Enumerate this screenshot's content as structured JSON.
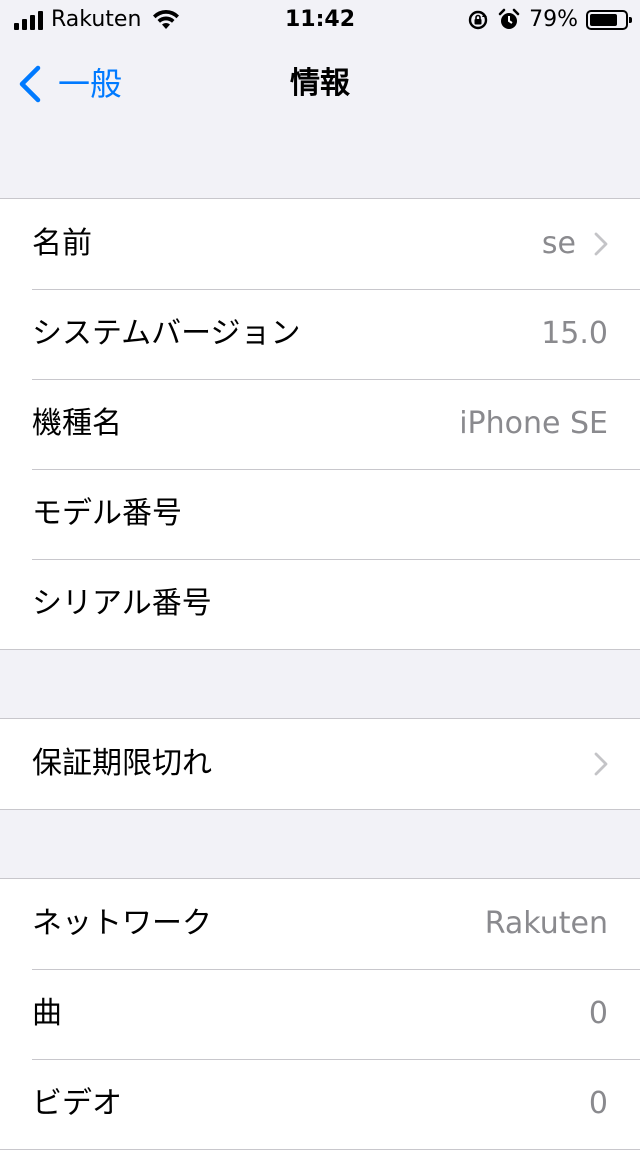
{
  "status_bar": {
    "carrier": "Rakuten",
    "time": "11:42",
    "battery_percent": "79%",
    "battery_level": 0.79,
    "signal_icon": "cellular-signal-icon",
    "wifi_icon": "wifi-icon",
    "rotation_lock_icon": "rotation-lock-icon",
    "alarm_icon": "alarm-clock-icon"
  },
  "nav": {
    "back_label": "一般",
    "title": "情報",
    "accent_color": "#007aff"
  },
  "group1": {
    "rows": [
      {
        "label": "名前",
        "value": "se",
        "chevron": true
      },
      {
        "label": "システムバージョン",
        "value": "15.0"
      },
      {
        "label": "機種名",
        "value": "iPhone SE"
      },
      {
        "label": "モデル番号",
        "value": ""
      },
      {
        "label": "シリアル番号",
        "value": ""
      }
    ]
  },
  "group2": {
    "rows": [
      {
        "label": "保証期限切れ",
        "value": "",
        "chevron": true
      }
    ]
  },
  "group3": {
    "rows": [
      {
        "label": "ネットワーク",
        "value": "Rakuten"
      },
      {
        "label": "曲",
        "value": "0"
      },
      {
        "label": "ビデオ",
        "value": "0"
      }
    ]
  }
}
